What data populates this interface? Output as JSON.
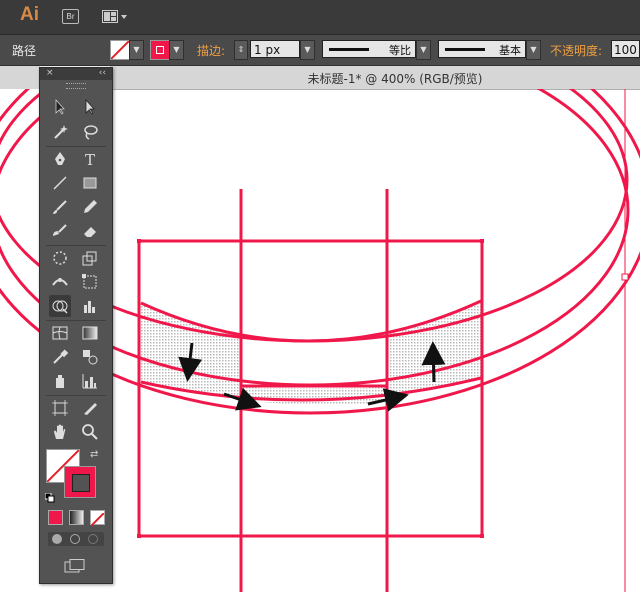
{
  "app": {
    "logo": "Ai",
    "bridge": "Br"
  },
  "control_bar": {
    "selection_type": "路径",
    "stroke_label": "描边:",
    "stroke_weight": "1 px",
    "profile_1": "等比",
    "profile_2": "基本",
    "opacity_label": "不透明度:",
    "opacity_value": "100"
  },
  "document": {
    "tab_title": "未标题-1* @ 400% (RGB/预览)"
  },
  "toolbox": {
    "close_glyph": "×",
    "collapse_glyph": "‹‹",
    "fill_color": "#ffffff",
    "stroke_color": "#f0184a"
  },
  "colors": {
    "artwork_stroke": "#f0184a",
    "hatch_fill": "#dcdcdc",
    "arrow": "#111111"
  }
}
